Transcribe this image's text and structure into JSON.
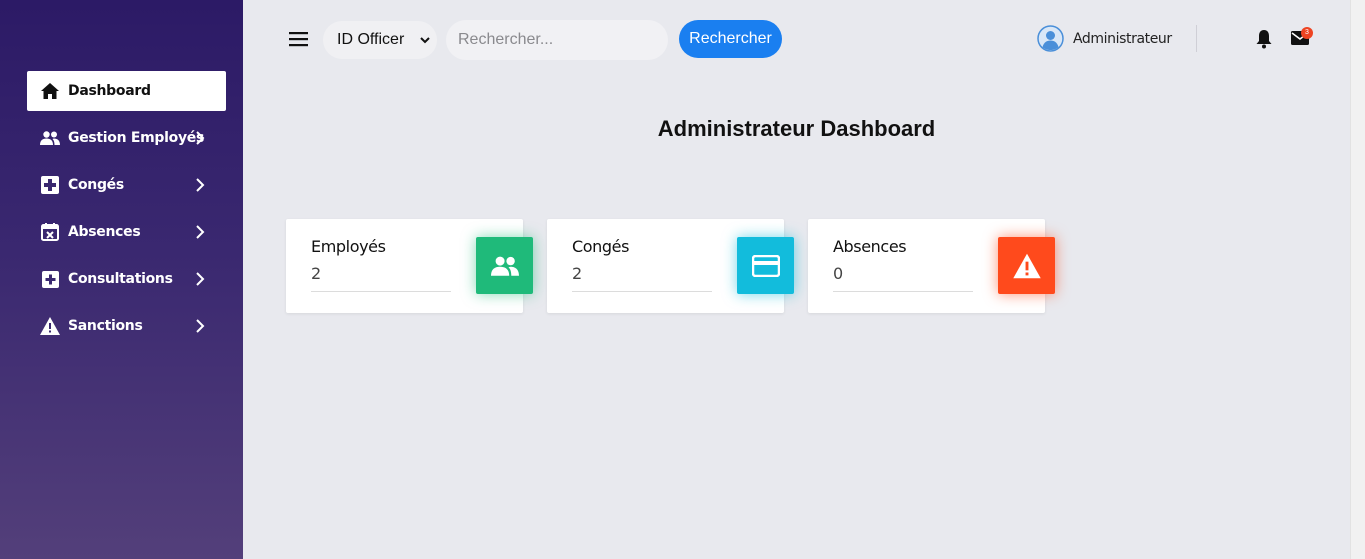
{
  "sidebar": {
    "items": [
      {
        "label": "Dashboard",
        "icon": "home-icon",
        "active": true
      },
      {
        "label": "Gestion Employés",
        "icon": "people-icon"
      },
      {
        "label": "Congés",
        "icon": "medical-kit-icon"
      },
      {
        "label": "Absences",
        "icon": "calendar-x-icon"
      },
      {
        "label": "Consultations",
        "icon": "plus-square-icon"
      },
      {
        "label": "Sanctions",
        "icon": "warning-icon"
      }
    ]
  },
  "topbar": {
    "select_value": "ID Officer",
    "search_placeholder": "Rechercher...",
    "search_button": "Rechercher",
    "user_name": "Administrateur",
    "mail_badge": "3"
  },
  "main": {
    "title": "Administrateur Dashboard",
    "cards": [
      {
        "label": "Employés",
        "value": "2",
        "color": "#1fba7a",
        "icon": "people-icon"
      },
      {
        "label": "Congés",
        "value": "2",
        "color": "#12bcdc",
        "icon": "credit-card-icon"
      },
      {
        "label": "Absences",
        "value": "0",
        "color": "#ff4a1c",
        "icon": "warning-icon"
      }
    ]
  },
  "colors": {
    "sidebar_top": "#2c1a66",
    "sidebar_bottom": "#533f7a",
    "accent": "#1a7ff0"
  }
}
